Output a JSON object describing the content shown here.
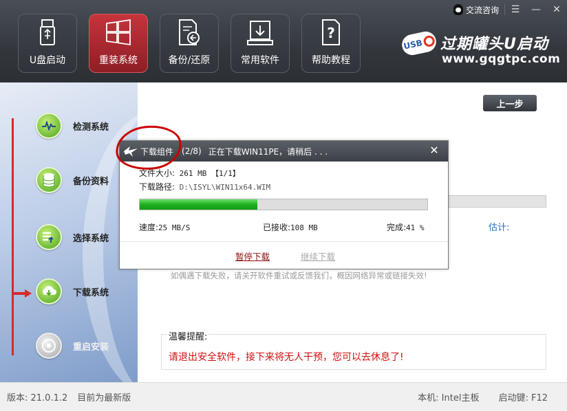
{
  "window": {
    "consult_label": "交流咨询",
    "menu_icon": "menu-icon",
    "min_icon": "minimize-icon",
    "close_icon": "close-icon"
  },
  "nav": [
    {
      "label": "U盘启动",
      "icon": "usb-drive-icon",
      "active": false
    },
    {
      "label": "重装系统",
      "icon": "windows-icon",
      "active": true
    },
    {
      "label": "备份/还原",
      "icon": "backup-restore-icon",
      "active": false
    },
    {
      "label": "常用软件",
      "icon": "software-download-icon",
      "active": false
    },
    {
      "label": "帮助教程",
      "icon": "help-document-icon",
      "active": false
    }
  ],
  "brand": {
    "badge": "USB",
    "title": "过期罐头U启动",
    "url": "www.gqgtpc.com"
  },
  "sidebar": {
    "steps": [
      {
        "label": "检测系统",
        "icon": "detect-icon"
      },
      {
        "label": "备份资料",
        "icon": "database-icon"
      },
      {
        "label": "选择系统",
        "icon": "select-list-icon"
      },
      {
        "label": "下载系统",
        "icon": "cloud-download-icon"
      },
      {
        "label": "重启安装",
        "icon": "restart-disc-icon"
      }
    ]
  },
  "main": {
    "prev_button": "上一步",
    "estimate_label": "估计:",
    "hint": "如偶遇下载失败，请关开软件重试或反馈我们，概因网络异常或链接失效!",
    "tips_title": "温馨提醒:",
    "tips_text": "请退出安全软件，接下来将无人干预，您可以去休息了!"
  },
  "dialog": {
    "title": "下载组件",
    "count": "(2/8)",
    "status": "正在下载WIN11PE，请稍后 . . .",
    "file_size_label": "文件大小:",
    "file_size_value": "261 MB 【1/1】",
    "path_label": "下载路径:",
    "path_value": "D:\\ISYL\\WIN11x64.WIM",
    "progress": 0.41,
    "speed_label": "速度:",
    "speed_value": "25 MB/S",
    "received_label": "已接收:",
    "received_value": "108 MB",
    "done_label": "完成:",
    "done_value": "41 %",
    "pause_label": "暂停下载",
    "resume_label": "继续下载"
  },
  "footer": {
    "version": "版本: 21.0.1.2",
    "latest": "目前为最新版",
    "machine": "本机: Intel主板",
    "boot_key": "启动键: F12"
  }
}
